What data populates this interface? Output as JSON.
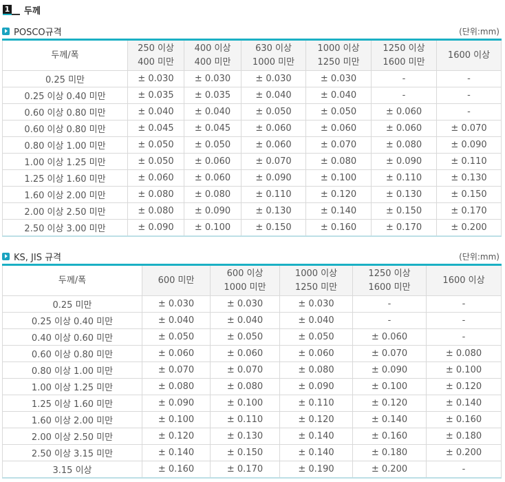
{
  "page_title": "두께",
  "section_number": "1",
  "posco": {
    "title": "POSCO규격",
    "unit": "(단위:mm)",
    "corner_label": "두께/폭",
    "headers": [
      [
        "250 이상",
        "400 미만"
      ],
      [
        "400 이상",
        "400 미만"
      ],
      [
        "630 이상",
        "1000 미만"
      ],
      [
        "1000 이상",
        "1250 미만"
      ],
      [
        "1250 이상",
        "1600 미만"
      ],
      [
        "1600 이상"
      ]
    ],
    "rows": [
      {
        "label": "0.25 미만",
        "cells": [
          "± 0.030",
          "± 0.030",
          "± 0.030",
          "± 0.030",
          "-",
          "-"
        ]
      },
      {
        "label": "0.25 이상 0.40 미만",
        "cells": [
          "± 0.035",
          "± 0.035",
          "± 0.040",
          "± 0.040",
          "-",
          "-"
        ]
      },
      {
        "label": "0.60 이상 0.80 미만",
        "cells": [
          "± 0.040",
          "± 0.040",
          "± 0.050",
          "± 0.050",
          "± 0.060",
          "-"
        ]
      },
      {
        "label": "0.60 이상 0.80 미만",
        "cells": [
          "± 0.045",
          "± 0.045",
          "± 0.060",
          "± 0.060",
          "± 0.060",
          "± 0.070"
        ]
      },
      {
        "label": "0.80 이상 1.00 미만",
        "cells": [
          "± 0.050",
          "± 0.050",
          "± 0.060",
          "± 0.070",
          "± 0.080",
          "± 0.090"
        ]
      },
      {
        "label": "1.00 이상 1.25 미만",
        "cells": [
          "± 0.050",
          "± 0.060",
          "± 0.070",
          "± 0.080",
          "± 0.090",
          "± 0.110"
        ]
      },
      {
        "label": "1.25 이상 1.60 미만",
        "cells": [
          "± 0.060",
          "± 0.060",
          "± 0.090",
          "± 0.100",
          "± 0.110",
          "± 0.130"
        ]
      },
      {
        "label": "1.60 이상 2.00 미만",
        "cells": [
          "± 0.080",
          "± 0.080",
          "± 0.110",
          "± 0.120",
          "± 0.130",
          "± 0.150"
        ]
      },
      {
        "label": "2.00 이상 2.50 미만",
        "cells": [
          "± 0.080",
          "± 0.090",
          "± 0.130",
          "± 0.140",
          "± 0.150",
          "± 0.170"
        ]
      },
      {
        "label": "2.50 이상 3.00 미만",
        "cells": [
          "± 0.090",
          "± 0.100",
          "± 0.150",
          "± 0.160",
          "± 0.170",
          "± 0.200"
        ]
      }
    ]
  },
  "ks_jis": {
    "title": "KS, JIS 규격",
    "unit": "(단위:mm)",
    "corner_label": "두께/폭",
    "headers": [
      [
        "600 미만"
      ],
      [
        "600 이상",
        "1000 미만"
      ],
      [
        "1000 이상",
        "1250 미만"
      ],
      [
        "1250 이상",
        "1600 미만"
      ],
      [
        "1600 이상"
      ]
    ],
    "rows": [
      {
        "label": "0.25 미만",
        "cells": [
          "± 0.030",
          "± 0.030",
          "± 0.030",
          "-",
          "-"
        ]
      },
      {
        "label": "0.25 이상 0.40 미만",
        "cells": [
          "± 0.040",
          "± 0.040",
          "± 0.040",
          "-",
          "-"
        ]
      },
      {
        "label": "0.40 이상 0.60 미만",
        "cells": [
          "± 0.050",
          "± 0.050",
          "± 0.050",
          "± 0.060",
          "-"
        ]
      },
      {
        "label": "0.60 이상 0.80 미만",
        "cells": [
          "± 0.060",
          "± 0.060",
          "± 0.060",
          "± 0.070",
          "± 0.080"
        ]
      },
      {
        "label": "0.80 이상 1.00 미만",
        "cells": [
          "± 0.070",
          "± 0.070",
          "± 0.080",
          "± 0.090",
          "± 0.100"
        ]
      },
      {
        "label": "1.00 이상 1.25 미만",
        "cells": [
          "± 0.080",
          "± 0.080",
          "± 0.090",
          "± 0.100",
          "± 0.120"
        ]
      },
      {
        "label": "1.25 이상 1.60 미만",
        "cells": [
          "± 0.090",
          "± 0.100",
          "± 0.110",
          "± 0.120",
          "± 0.140"
        ]
      },
      {
        "label": "1.60 이상 2.00 미만",
        "cells": [
          "± 0.100",
          "± 0.110",
          "± 0.120",
          "± 0.140",
          "± 0.160"
        ]
      },
      {
        "label": "2.00 이상 2.50 미만",
        "cells": [
          "± 0.120",
          "± 0.130",
          "± 0.140",
          "± 0.160",
          "± 0.180"
        ]
      },
      {
        "label": "2.50 이상 3.15 미만",
        "cells": [
          "± 0.140",
          "± 0.150",
          "± 0.140",
          "± 0.180",
          "± 0.200"
        ]
      },
      {
        "label": "3.15 이상",
        "cells": [
          "± 0.160",
          "± 0.170",
          "± 0.190",
          "± 0.200",
          "-"
        ]
      }
    ]
  }
}
